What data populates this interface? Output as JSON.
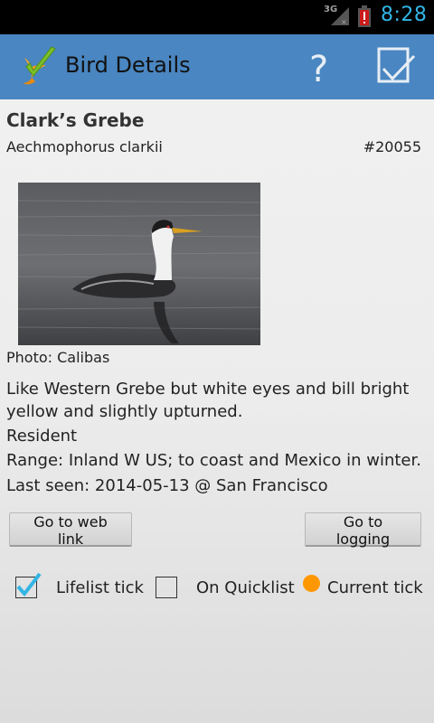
{
  "status_bar": {
    "network_label": "3G",
    "time": "8:28",
    "colors": {
      "clock": "#33b5e5",
      "battery_alert": "#cc1b1b"
    }
  },
  "action_bar": {
    "title": "Bird Details",
    "icons": [
      "bird-logo-icon",
      "help-icon",
      "checklist-icon"
    ],
    "colors": {
      "background": "#4a86c1",
      "logo_check": "#7bbf2a",
      "logo_bird": "#f0a020"
    }
  },
  "bird": {
    "common_name": "Clark’s Grebe",
    "scientific_name": "Aechmophorus clarkii",
    "id": "#20055",
    "photo_credit": "Photo: Calibas",
    "description": "Like Western Grebe but white eyes and bill bright yellow and slightly upturned.",
    "status": "Resident",
    "range": "Range: Inland W US; to coast and Mexico in winter.",
    "last_seen": "Last seen: 2014-05-13 @ San Francisco"
  },
  "buttons": {
    "web_link": "Go to web link",
    "logging": "Go to logging"
  },
  "ticks": {
    "lifelist": {
      "label": "Lifelist tick",
      "checked": true
    },
    "quicklist": {
      "label": "On Quicklist",
      "checked": false
    },
    "current": {
      "label": "Current tick",
      "indicator_color": "#ff9800"
    }
  }
}
